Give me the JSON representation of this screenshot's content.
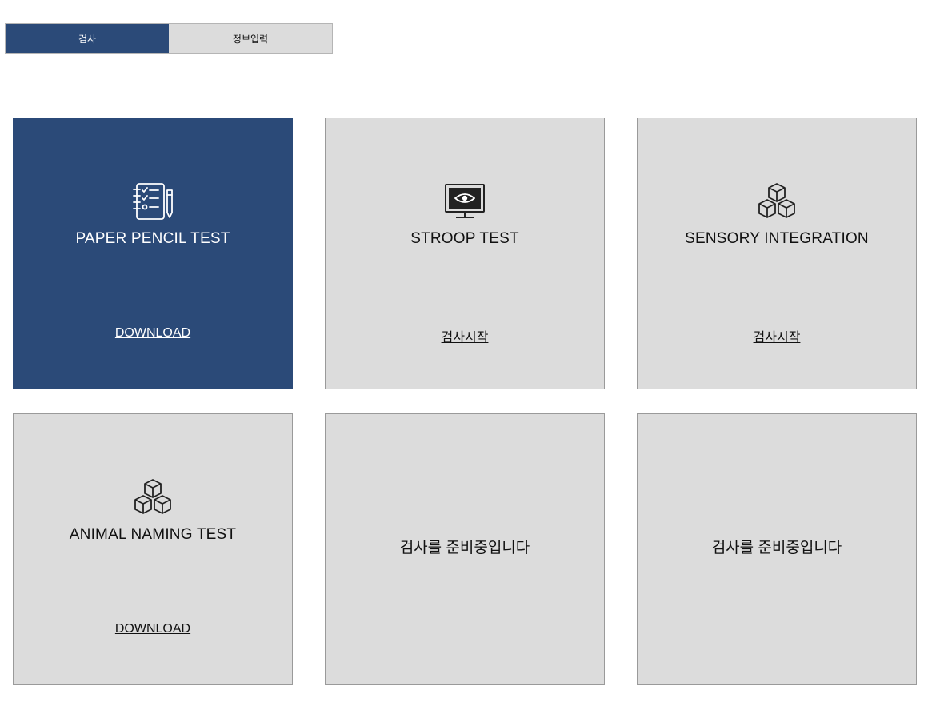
{
  "tabs": [
    {
      "label": "검사",
      "active": true
    },
    {
      "label": "정보입력",
      "active": false
    }
  ],
  "cards": [
    {
      "title": "PAPER PENCIL TEST",
      "action": "DOWNLOAD",
      "icon": "checklist-pen-icon"
    },
    {
      "title": "STROOP TEST",
      "action": "검사시작",
      "icon": "monitor-eye-icon"
    },
    {
      "title": "SENSORY INTEGRATION",
      "action": "검사시작",
      "icon": "cubes-icon"
    },
    {
      "title": "ANIMAL NAMING TEST",
      "action": "DOWNLOAD",
      "icon": "cubes-icon"
    },
    {
      "pending_text": "검사를 준비중입니다"
    },
    {
      "pending_text": "검사를 준비중입니다"
    }
  ],
  "colors": {
    "accent": "#2b4a78",
    "card_bg": "#dcdcdc"
  }
}
